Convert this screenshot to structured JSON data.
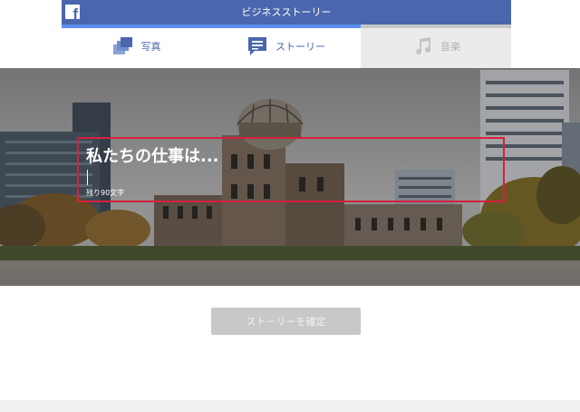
{
  "topbar": {
    "logo": "facebook-logo",
    "logo_letter": "f",
    "title": "ビジネスストーリー"
  },
  "tabs": [
    {
      "label": "写真",
      "icon": "photos-icon",
      "state": "active"
    },
    {
      "label": "ストーリー",
      "icon": "story-icon",
      "state": "active"
    },
    {
      "label": "音楽",
      "icon": "music-icon",
      "state": "disabled"
    }
  ],
  "editor": {
    "headline": "私たちの仕事は...",
    "remaining_chars": "残り90文字"
  },
  "confirm_button": {
    "label": "ストーリーを確定",
    "state": "disabled"
  },
  "colors": {
    "brand": "#4a67ad",
    "tab_indicator": "#5b8dee",
    "frame": "#d6203e",
    "button_disabled": "#c8c8c8"
  }
}
